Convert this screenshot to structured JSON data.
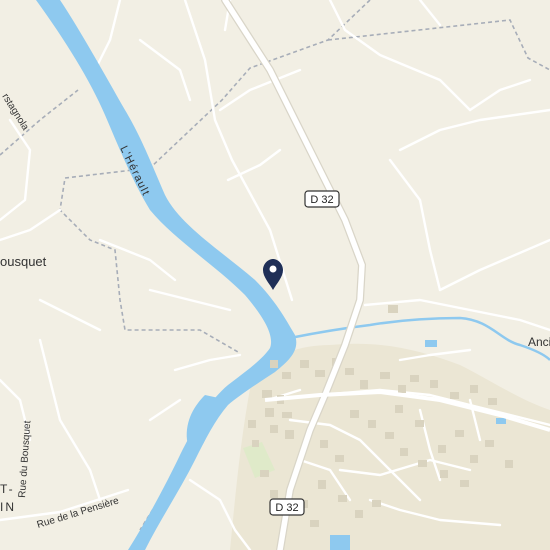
{
  "map": {
    "labels": {
      "river": "L'Hérault",
      "road_north": "D 32",
      "road_south": "D 32",
      "place_west": "ousquet",
      "street_nw": "rstagnola",
      "street_bousquet": "Rue du Bousquet",
      "street_pensiere": "Rue de la Pensière",
      "place_sw_1": "T-",
      "place_sw_2": "IN",
      "place_east": "Anci"
    },
    "icons": {
      "marker": "location-pin-icon"
    },
    "colors": {
      "land": "#f2efe4",
      "water": "#8ec9ef",
      "road_main": "#ffffff",
      "road_minor": "#ffffff",
      "boundary": "#a7adb8",
      "urban": "#e8e3cf",
      "marker": "#1f2f57"
    }
  }
}
